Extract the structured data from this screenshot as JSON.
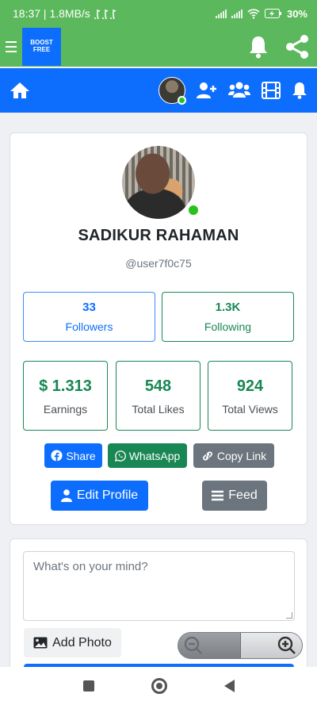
{
  "status_bar": {
    "time_speed": "18:37 | 1.8MB/s",
    "battery": "30%"
  },
  "appbar": {
    "brand": "BOOST FREE",
    "icons": [
      "menu-icon",
      "bell-icon",
      "share-icon"
    ]
  },
  "navbar": {
    "icons": [
      "home-icon",
      "add-user-icon",
      "users-icon",
      "film-icon",
      "bell-icon"
    ]
  },
  "profile": {
    "name": "SADIKUR RAHAMAN",
    "handle": "@user7f0c75",
    "online_color": "#28c21a",
    "stats_top": [
      {
        "value": "33",
        "label": "Followers",
        "color": "#0d6efd"
      },
      {
        "value": "1.3K",
        "label": "Following",
        "color": "#198754"
      }
    ],
    "stats_bottom": [
      {
        "value": "$ 1.313",
        "label": "Earnings"
      },
      {
        "value": "548",
        "label": "Total Likes"
      },
      {
        "value": "924",
        "label": "Total Views"
      }
    ],
    "share_buttons": {
      "share": "Share",
      "whatsapp": "WhatsApp",
      "copy_link": "Copy Link"
    },
    "actions": {
      "edit_profile": "Edit Profile",
      "feed": "Feed"
    }
  },
  "post": {
    "placeholder": "What's on your mind?",
    "add_photo": "Add Photo"
  },
  "colors": {
    "primary": "#0d6efd",
    "success": "#198754",
    "secondary": "#6c757d",
    "header_green": "#5cb85c"
  }
}
